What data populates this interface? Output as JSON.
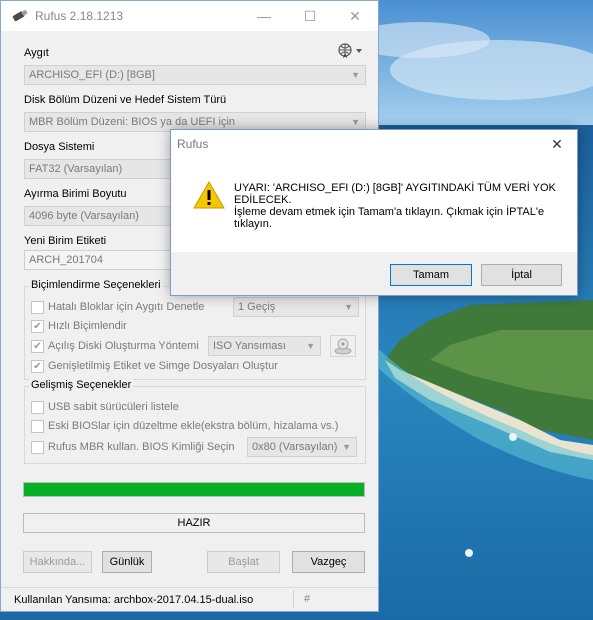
{
  "window": {
    "title": "Rufus 2.18.1213",
    "controls": {
      "minimize": "—",
      "maximize": "☐",
      "close": "✕"
    }
  },
  "device": {
    "label": "Aygıt",
    "value": "ARCHISO_EFI (D:) [8GB]"
  },
  "partition": {
    "label": "Disk Bölüm Düzeni ve Hedef Sistem Türü",
    "value": "MBR Bölüm Düzeni: BIOS ya da UEFI için"
  },
  "filesystem": {
    "label": "Dosya Sistemi",
    "value": "FAT32 (Varsayılan)"
  },
  "cluster": {
    "label": "Ayırma Birimi Boyutu",
    "value": "4096 byte (Varsayılan)"
  },
  "volume": {
    "label": "Yeni Birim Etiketi",
    "value": "ARCH_201704"
  },
  "format_options": {
    "title": "Biçimlendirme Seçenekleri",
    "bad_blocks": {
      "label": "Hatalı Bloklar için Aygıtı Denetle",
      "checked": false,
      "passes": "1 Geçiş"
    },
    "quick_format": {
      "label": "Hızlı Biçimlendir",
      "checked": true
    },
    "bootable": {
      "label": "Açılış Diski Oluşturma Yöntemi",
      "checked": true,
      "method": "ISO Yansıması"
    },
    "extended_label": {
      "label": "Genişletilmiş Etiket ve Simge Dosyaları Oluştur",
      "checked": true
    }
  },
  "advanced_options": {
    "title": "Gelişmiş Seçenekler",
    "usb_fixed": {
      "label": "USB sabit sürücüleri listele",
      "checked": false
    },
    "old_bios": {
      "label": "Eski BIOSlar için düzeltme ekle(ekstra bölüm, hizalama vs.)",
      "checked": false
    },
    "rufus_mbr": {
      "label": "Rufus MBR kullan. BIOS Kimliği Seçin",
      "checked": false,
      "bios_id": "0x80 (Varsayılan)"
    }
  },
  "progress": {
    "fraction": 1.0
  },
  "status": {
    "text": "HAZIR"
  },
  "buttons": {
    "about": "Hakkında...",
    "log": "Günlük",
    "start": "Başlat",
    "cancel": "Vazgeç"
  },
  "statusbar": {
    "text": "Kullanılan Yansıma: archbox-2017.04.15-dual.iso",
    "hash": "#"
  },
  "dialog": {
    "title": "Rufus",
    "close": "✕",
    "line1": "UYARI: 'ARCHISO_EFI (D:) [8GB]' AYGITINDAKİ TÜM VERİ YOK",
    "line2": "EDİLECEK.",
    "line3": "İşleme devam etmek için Tamam'a tıklayın. Çıkmak için İPTAL'e",
    "line4": "tıklayın.",
    "ok": "Tamam",
    "cancel": "İptal"
  },
  "colors": {
    "progress": "#06b025",
    "accent": "#0078d7"
  }
}
